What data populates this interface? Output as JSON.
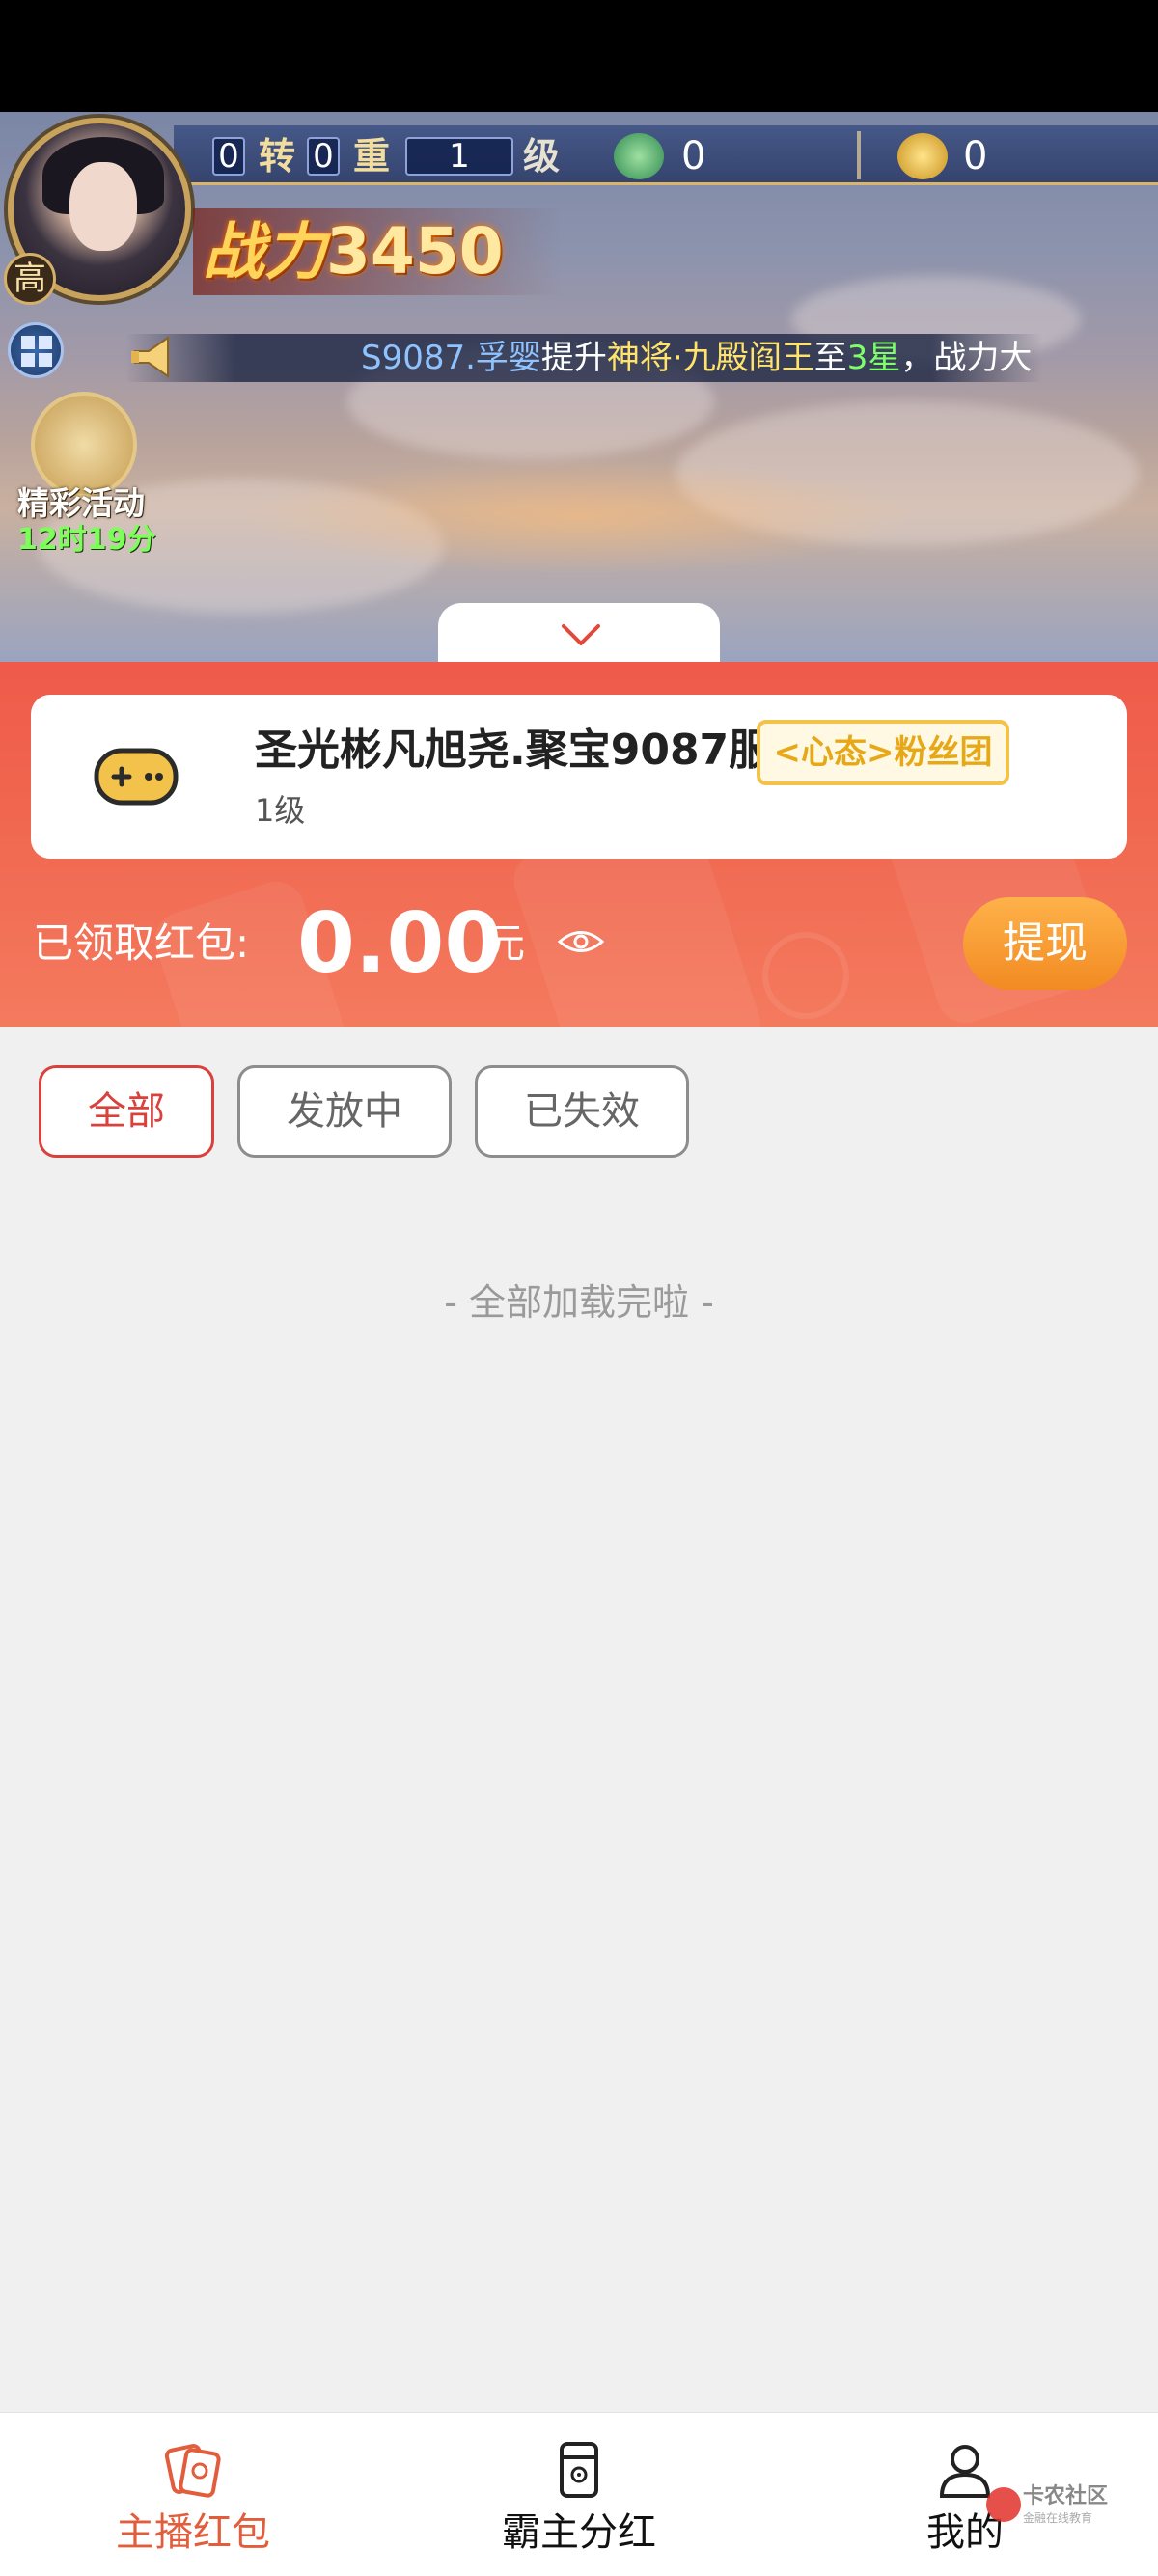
{
  "colors": {
    "accent_red": "#d9413c",
    "panel_red": "#ef5a4a",
    "withdraw_orange": "#f28a22",
    "fan_badge_gold": "#e6a817",
    "active_nav": "#e25d3c"
  },
  "game": {
    "rebirth_count": "0",
    "rebirth_label": "转",
    "layer_count": "0",
    "layer_label": "重",
    "level": "1",
    "level_label": "级",
    "jade_count": "0",
    "gold_count": "0",
    "rank_badge": "高",
    "power_label": "战力",
    "power_value": "3450",
    "broadcast": {
      "server_player": "S9087.孚婴",
      "verb": "提升",
      "target": "神将·九殿阎王",
      "to": "至",
      "stars": "3星",
      "tail": "，战力大"
    },
    "activity": {
      "label": "精彩活动",
      "timer": "12时19分"
    },
    "collapse_icon": "chevron-down-icon"
  },
  "anchor": {
    "name": "圣光彬凡旭尧.聚宝9087服",
    "level": "1级",
    "fan_badge": "<心态>粉丝团",
    "icon": "gamepad-icon"
  },
  "wallet": {
    "received_label": "已领取红包:",
    "amount": "0.00",
    "unit": "元",
    "withdraw_label": "提现"
  },
  "filters": [
    {
      "label": "全部",
      "active": true
    },
    {
      "label": "发放中",
      "active": false
    },
    {
      "label": "已失效",
      "active": false
    }
  ],
  "list_end_text": "- 全部加载完啦 -",
  "bottom_nav": [
    {
      "label": "主播红包",
      "icon": "red-packet-icon",
      "active": true
    },
    {
      "label": "霸主分红",
      "icon": "dividend-icon",
      "active": false
    },
    {
      "label": "我的",
      "icon": "user-icon",
      "active": false
    }
  ],
  "watermark": {
    "title": "卡农社区",
    "subtitle": "金融在线教育"
  }
}
